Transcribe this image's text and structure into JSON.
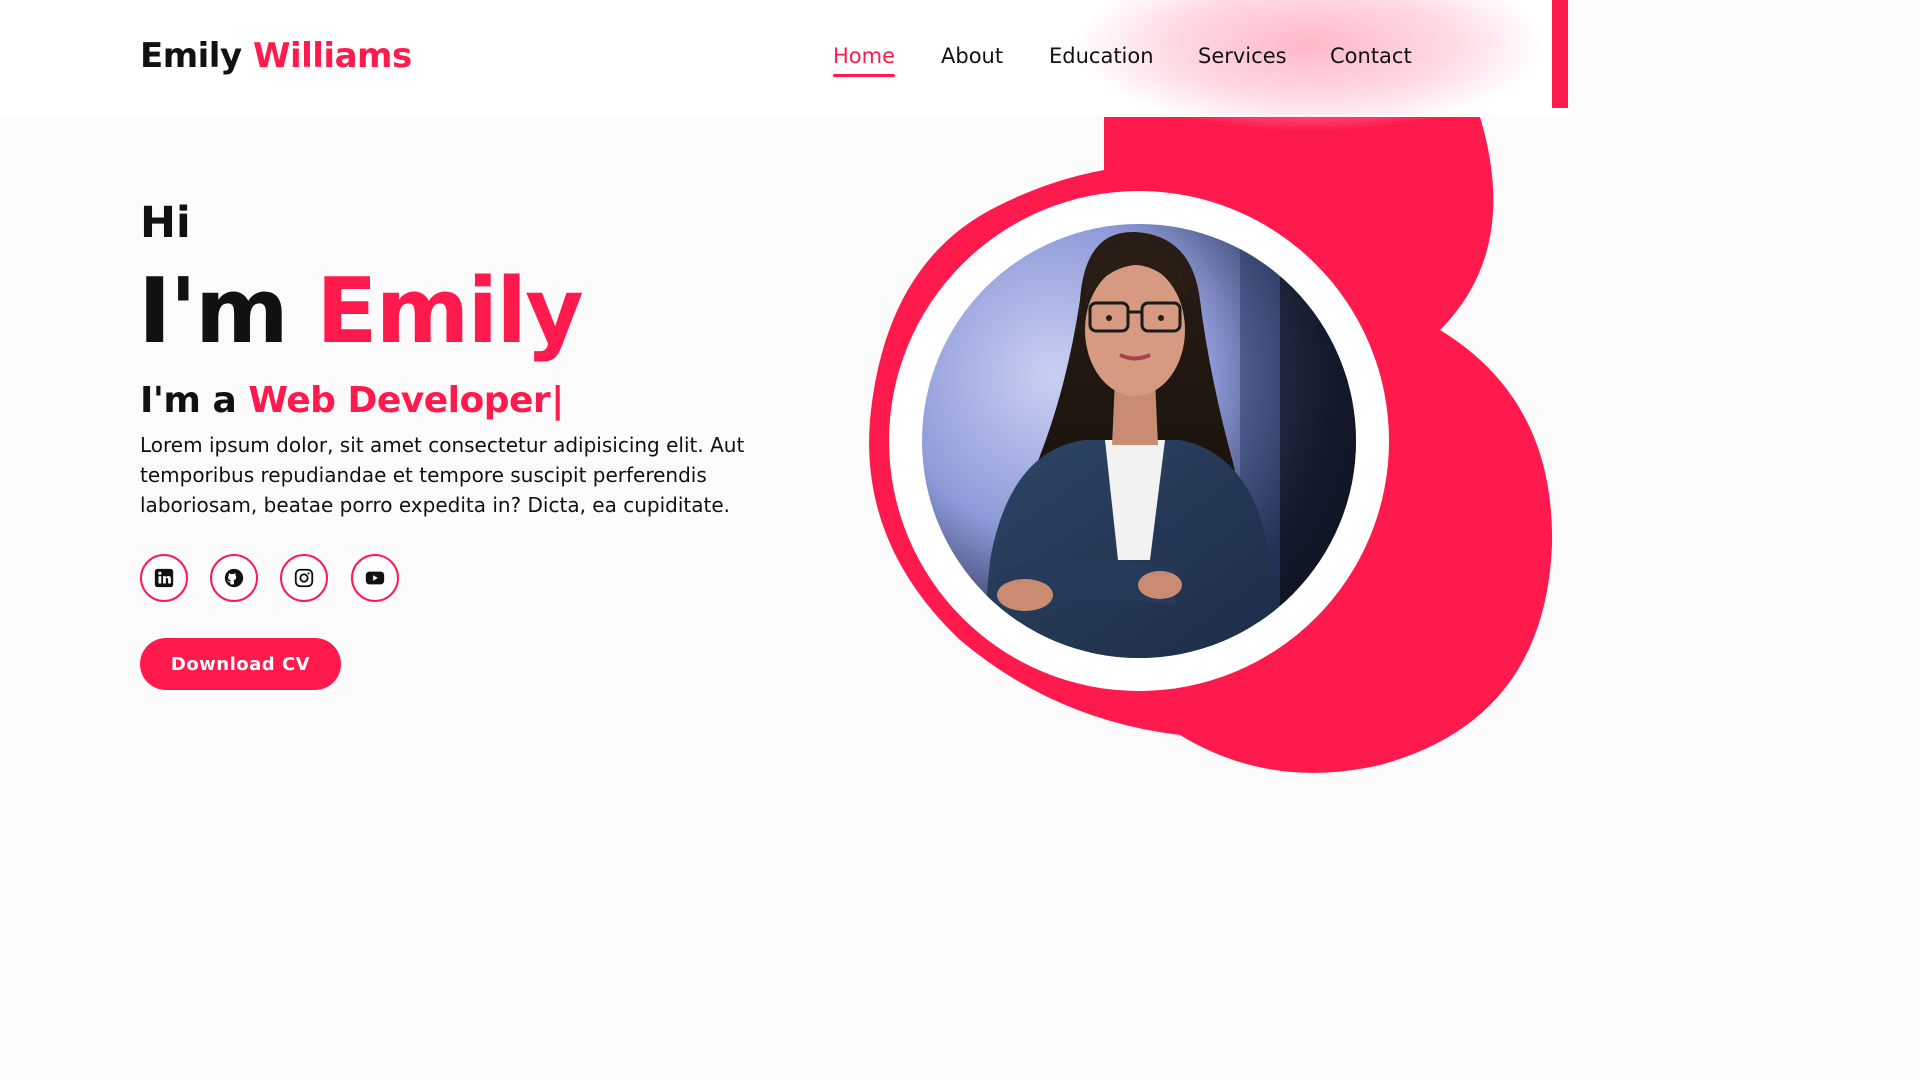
{
  "header": {
    "logo_first": "Emily",
    "logo_last": "Williams",
    "nav": [
      {
        "label": "Home",
        "active": true
      },
      {
        "label": "About",
        "active": false
      },
      {
        "label": "Education",
        "active": false
      },
      {
        "label": "Services",
        "active": false
      },
      {
        "label": "Contact",
        "active": false
      }
    ]
  },
  "hero": {
    "greeting": "Hi",
    "intro_prefix": "I'm",
    "intro_name": "Emily",
    "role_prefix": "I'm a",
    "role_title": "Web Developer",
    "cursor": "|",
    "description": "Lorem ipsum dolor, sit amet consectetur adipisicing elit. Aut temporibus repudiandae et tempore suscipit perferendis laboriosam, beatae porro expedita in? Dicta, ea cupiditate.",
    "socials": [
      {
        "icon": "linkedin-icon"
      },
      {
        "icon": "github-icon"
      },
      {
        "icon": "instagram-icon"
      },
      {
        "icon": "youtube-icon"
      }
    ],
    "cv_button": "Download CV"
  },
  "theme": {
    "accent": "#ff1a4d",
    "background": "#fbfbfc"
  }
}
